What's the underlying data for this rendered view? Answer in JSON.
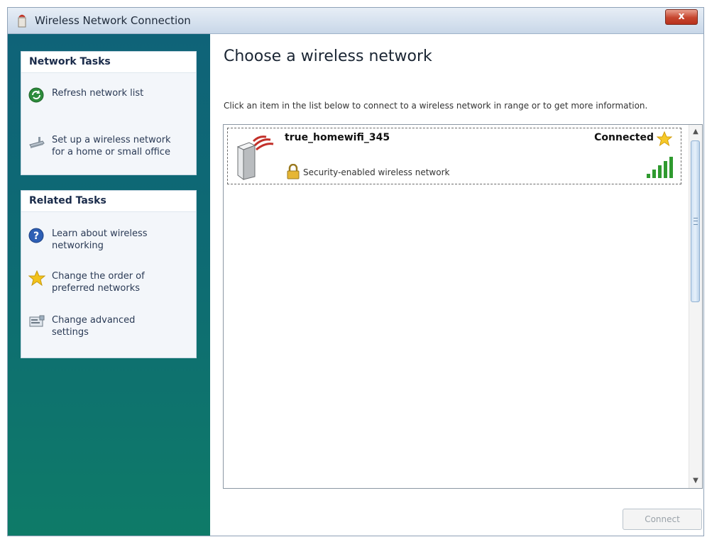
{
  "window": {
    "title": "Wireless Network Connection",
    "close_label": "x"
  },
  "sidebar": {
    "network_tasks": {
      "header": "Network Tasks",
      "items": [
        {
          "label": "Refresh network list",
          "icon": "refresh-icon"
        },
        {
          "label": "Set up a wireless network for a home or small office",
          "icon": "setup-network-icon"
        }
      ]
    },
    "related_tasks": {
      "header": "Related Tasks",
      "items": [
        {
          "label": "Learn about wireless networking",
          "icon": "help-icon"
        },
        {
          "label": "Change the order of preferred networks",
          "icon": "star-icon"
        },
        {
          "label": "Change advanced settings",
          "icon": "settings-icon"
        }
      ]
    }
  },
  "main": {
    "heading": "Choose a wireless network",
    "instructions": "Click an item in the list below to connect to a wireless network in range or to get more information.",
    "networks": [
      {
        "name": "true_homewifi_345",
        "status": "Connected",
        "security": "Security-enabled wireless network",
        "signal_bars": 5,
        "preferred": true
      }
    ],
    "connect_label": "Connect"
  },
  "colors": {
    "sidebar_gradient_top": "#0f6378",
    "sidebar_gradient_bottom": "#0e7b68",
    "close_button": "#c6452e",
    "signal_green": "#2f9a2f",
    "star_gold": "#f2c21b"
  }
}
